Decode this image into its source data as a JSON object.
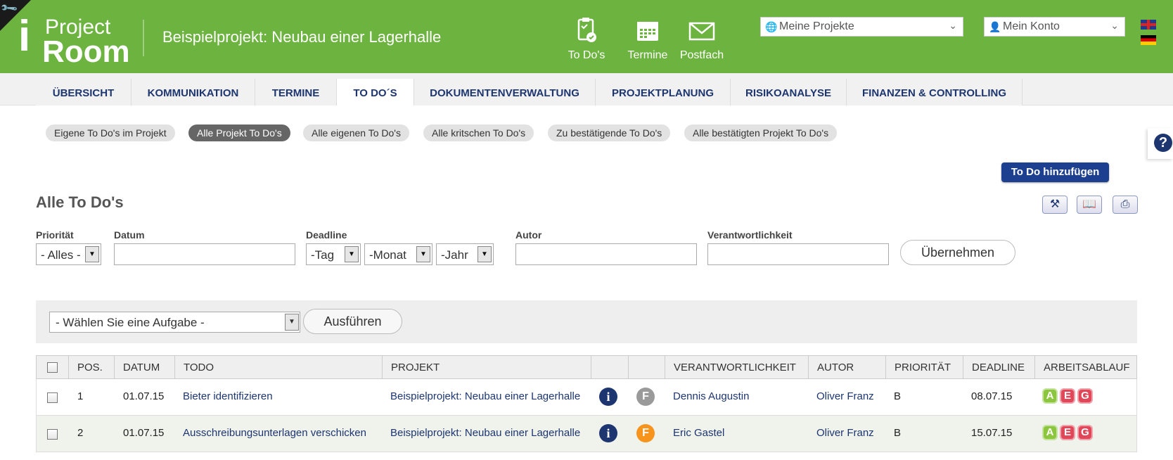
{
  "header": {
    "logo": {
      "i": "i",
      "project": "Project",
      "room": "Room"
    },
    "project_title": "Beispielprojekt: Neubau einer Lagerhalle",
    "nav": [
      {
        "label": "To Do's",
        "icon": "clipboard-check-icon"
      },
      {
        "label": "Termine",
        "icon": "calendar-icon"
      },
      {
        "label": "Postfach",
        "icon": "mail-icon"
      }
    ],
    "projects_select": "Meine Projekte",
    "account_select": "Mein Konto",
    "languages": [
      "en",
      "de"
    ]
  },
  "tabs": [
    {
      "label": "ÜBERSICHT"
    },
    {
      "label": "KOMMUNIKATION"
    },
    {
      "label": "TERMINE"
    },
    {
      "label": "TO DO´S"
    },
    {
      "label": "DOKUMENTENVERWALTUNG"
    },
    {
      "label": "PROJEKTPLANUNG"
    },
    {
      "label": "RISIKOANALYSE"
    },
    {
      "label": "FINANZEN & CONTROLLING"
    }
  ],
  "filters_pills": [
    {
      "label": "Eigene To Do's im Projekt"
    },
    {
      "label": "Alle Projekt To Do's"
    },
    {
      "label": "Alle eigenen To Do's"
    },
    {
      "label": "Alle kritschen To Do's"
    },
    {
      "label": "Zu bestätigende To Do's"
    },
    {
      "label": "Alle bestätigten Projekt To Do's"
    }
  ],
  "add_button": "To Do hinzufügen",
  "page_title": "Alle To Do's",
  "filter_form": {
    "prioritaet_label": "Priorität",
    "prioritaet_value": "- Alles -",
    "datum_label": "Datum",
    "deadline_label": "Deadline",
    "tag_value": "-Tag",
    "monat_value": "-Monat",
    "jahr_value": "-Jahr",
    "autor_label": "Autor",
    "verantwortlichkeit_label": "Verantwortlichkeit",
    "apply_button": "Übernehmen"
  },
  "action_bar": {
    "task_select": "- Wählen Sie eine Aufgabe -",
    "run_button": "Ausführen"
  },
  "table": {
    "columns": [
      "POS.",
      "DATUM",
      "TODO",
      "PROJEKT",
      "",
      "",
      "VERANTWORTLICHKEIT",
      "AUTOR",
      "PRIORITÄT",
      "DEADLINE",
      "ARBEITSABLAUF"
    ],
    "rows": [
      {
        "pos": "1",
        "datum": "01.07.15",
        "todo": "Bieter identifizieren",
        "projekt": "Beispielprojekt: Neubau einer Lagerhalle",
        "f_status": "grey",
        "verantwortlich": "Dennis Augustin",
        "autor": "Oliver Franz",
        "prioritaet": "B",
        "deadline": "08.07.15"
      },
      {
        "pos": "2",
        "datum": "01.07.15",
        "todo": "Ausschreibungsunterlagen verschicken",
        "projekt": "Beispielprojekt: Neubau einer Lagerhalle",
        "f_status": "orange",
        "verantwortlich": "Eric Gastel",
        "autor": "Oliver Franz",
        "prioritaet": "B",
        "deadline": "15.07.15"
      }
    ],
    "info_icon_text": "i",
    "f_icon_text": "F",
    "workflow": [
      "A",
      "E",
      "G"
    ]
  },
  "colors": {
    "header_green": "#6db33f",
    "navy": "#1d3670",
    "f_grey": "#9a9a9a",
    "f_orange": "#f7941d",
    "wf_a": "#8cc63f",
    "wf_e": "#e0485a",
    "wf_g": "#e0485a"
  }
}
